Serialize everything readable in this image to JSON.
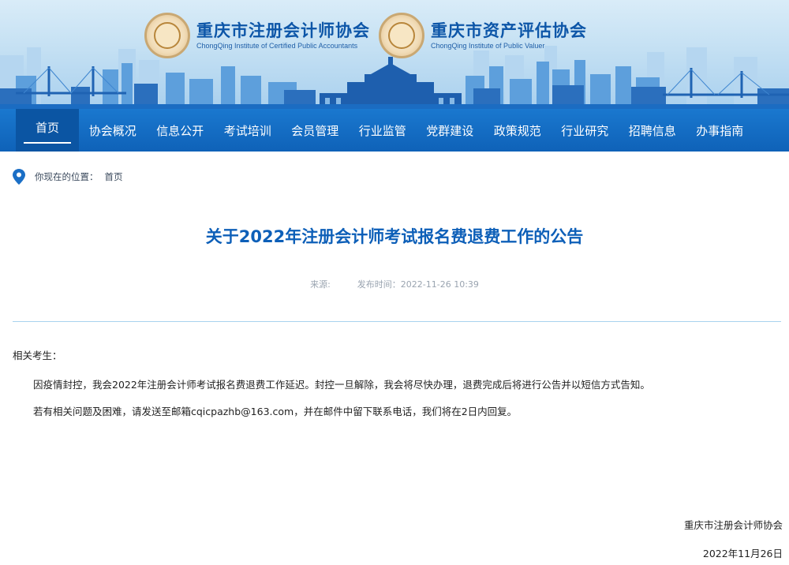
{
  "header": {
    "logo_left": {
      "name_cn": "重庆市注册会计师协会",
      "name_en": "ChongQing Institute of Certified Public Accountants"
    },
    "logo_right": {
      "name_cn": "重庆市资产评估协会",
      "name_en": "ChongQing Institute of Public Valuer"
    }
  },
  "nav": {
    "items": [
      "首页",
      "协会概况",
      "信息公开",
      "考试培训",
      "会员管理",
      "行业监管",
      "党群建设",
      "政策规范",
      "行业研究",
      "招聘信息",
      "办事指南"
    ],
    "active": "首页"
  },
  "breadcrumb": {
    "label": "你现在的位置：",
    "current": "首页"
  },
  "article": {
    "title": "关于2022年注册会计师考试报名费退费工作的公告",
    "source_label": "来源:",
    "publish_label": "发布时间：2022-11-26 10:39",
    "greeting": "相关考生：",
    "paragraphs": [
      "因疫情封控，我会2022年注册会计师考试报名费退费工作延迟。封控一旦解除，我会将尽快办理，退费完成后将进行公告并以短信方式告知。",
      "若有相关问题及困难，请发送至邮箱cqicpazhb@163.com，并在邮件中留下联系电话，我们将在2日内回复。"
    ],
    "signature": "重庆市注册会计师协会",
    "date": "2022年11月26日"
  },
  "colors": {
    "nav_bg": "#1a78cf",
    "nav_active": "#0b55a3",
    "title": "#0d5fb8",
    "divider": "#a9d3ee",
    "pin": "#1b6fc6"
  },
  "icons": {
    "breadcrumb": "location-pin-icon"
  }
}
